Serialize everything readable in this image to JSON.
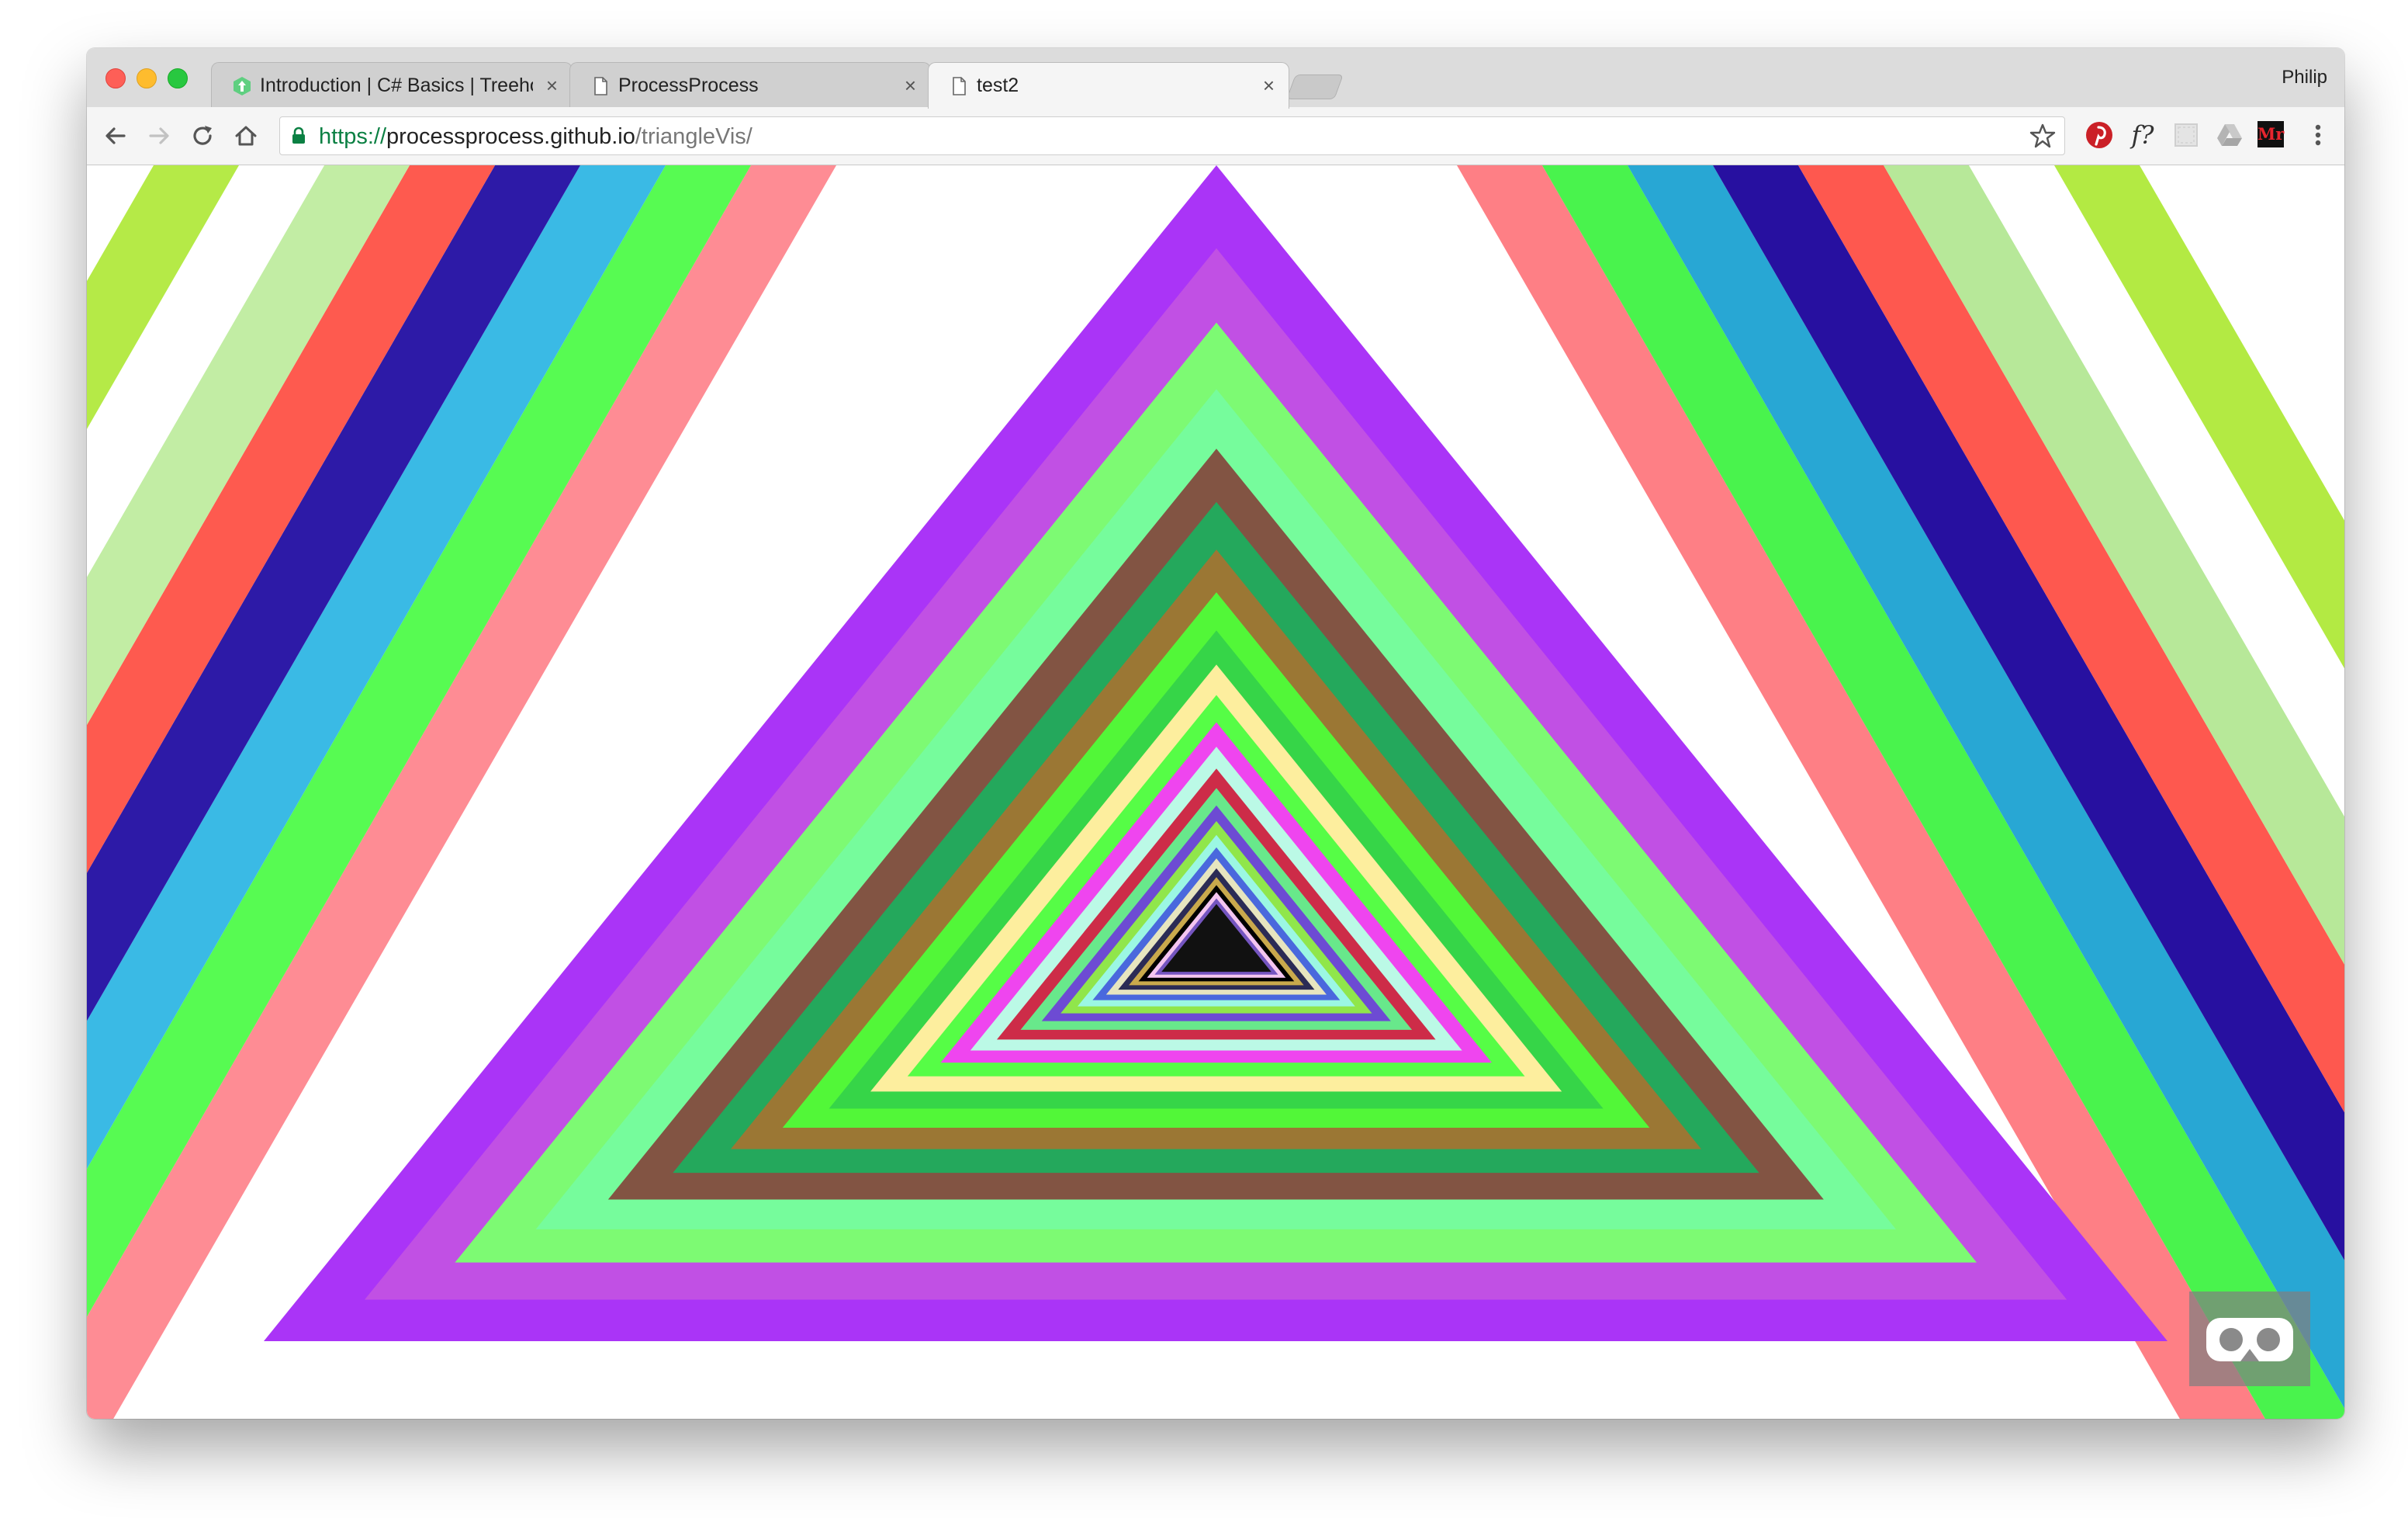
{
  "browser": {
    "profile_name": "Philip",
    "tabs": [
      {
        "title": "Introduction | C# Basics | Treehouse",
        "icon": "treehouse-favicon-icon",
        "active": false
      },
      {
        "title": "ProcessProcess",
        "icon": "page-icon",
        "active": false
      },
      {
        "title": "test2",
        "icon": "page-icon",
        "active": true
      }
    ],
    "close_glyph": "×",
    "url": {
      "scheme": "https://",
      "host": "processprocess.github.io",
      "path": "/triangleVis/"
    },
    "extensions": [
      "pinterest-icon",
      "font-finder-icon",
      "extension-icon",
      "drive-icon",
      "mercury-reader-icon",
      "menu-icon"
    ],
    "extension_labels": {
      "font_finder": "f?",
      "mercury": "Mr"
    }
  },
  "visualization": {
    "left_stripes": [
      "#b5ea47",
      "#ffffff",
      "#c2eda4",
      "#fe5a4f",
      "#2d1aa7",
      "#3abae5",
      "#57fb52",
      "#fe8c94",
      "#ffffff"
    ],
    "right_stripes": [
      "#ffffff",
      "#fe7f85",
      "#49f34d",
      "#28a7d4",
      "#2710a0",
      "#fe584f",
      "#b7e899",
      "#ffffff",
      "#b3ea43"
    ],
    "triangle_colors": [
      "#aa34f7",
      "#c150e4",
      "#7dfa73",
      "#76fc9c",
      "#825443",
      "#24a85c",
      "#9b7734",
      "#52f738",
      "#36d548",
      "#fdee9e",
      "#56fd46",
      "#ef45ef",
      "#bbf9e6",
      "#cd2c48",
      "#68e88b",
      "#6d4bd3",
      "#90e64b",
      "#9bf7e3",
      "#4a68dd",
      "#e7e5bf",
      "#2b2b55",
      "#c9a94c",
      "#000000",
      "#f4c5f0",
      "#7555c0",
      "#111111"
    ]
  },
  "vr_button": {
    "icon": "vr-headset-icon"
  }
}
